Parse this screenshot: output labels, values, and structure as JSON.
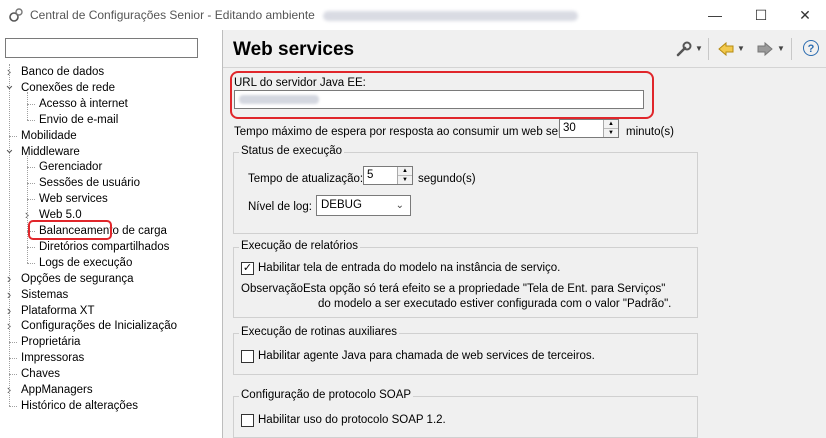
{
  "window": {
    "title": "Central de Configurações Senior - Editando ambiente",
    "minimize": "—",
    "maximize": "☐",
    "close": "✕"
  },
  "sidebar": {
    "search_value": "",
    "items": [
      {
        "label": "Banco de dados",
        "level": 0,
        "toggle": ">"
      },
      {
        "label": "Conexões de rede",
        "level": 0,
        "toggle": "v"
      },
      {
        "label": "Acesso à internet",
        "level": 1,
        "toggle": ""
      },
      {
        "label": "Envio de e-mail",
        "level": 1,
        "toggle": ""
      },
      {
        "label": "Mobilidade",
        "level": 0,
        "toggle": ""
      },
      {
        "label": "Middleware",
        "level": 0,
        "toggle": "v"
      },
      {
        "label": "Gerenciador",
        "level": 1,
        "toggle": ""
      },
      {
        "label": "Sessões de usuário",
        "level": 1,
        "toggle": ""
      },
      {
        "label": "Web services",
        "level": 1,
        "toggle": ""
      },
      {
        "label": "Web 5.0",
        "level": 1,
        "toggle": ">"
      },
      {
        "label": "Balanceamento de carga",
        "level": 1,
        "toggle": ""
      },
      {
        "label": "Diretórios compartilhados",
        "level": 1,
        "toggle": ""
      },
      {
        "label": "Logs de execução",
        "level": 1,
        "toggle": ""
      },
      {
        "label": "Opções de segurança",
        "level": 0,
        "toggle": ">"
      },
      {
        "label": "Sistemas",
        "level": 0,
        "toggle": ">"
      },
      {
        "label": "Plataforma XT",
        "level": 0,
        "toggle": ">"
      },
      {
        "label": "Configurações de Inicialização",
        "level": 0,
        "toggle": ">"
      },
      {
        "label": "Proprietária",
        "level": 0,
        "toggle": ""
      },
      {
        "label": "Impressoras",
        "level": 0,
        "toggle": ""
      },
      {
        "label": "Chaves",
        "level": 0,
        "toggle": ""
      },
      {
        "label": "AppManagers",
        "level": 0,
        "toggle": ">"
      },
      {
        "label": "Histórico de alterações",
        "level": 0,
        "toggle": ""
      }
    ]
  },
  "main": {
    "title": "Web services",
    "toolbar": {
      "help": "?"
    },
    "url_label": "URL do servidor Java EE:",
    "timeout_label": "Tempo máximo de espera por resposta ao consumir um web service:",
    "timeout_value": "30",
    "timeout_unit": "minuto(s)",
    "status_group": {
      "title": "Status de execução",
      "refresh_label": "Tempo de atualização:",
      "refresh_value": "5",
      "refresh_unit": "segundo(s)",
      "log_label": "Nível de log:",
      "log_value": "DEBUG"
    },
    "reports_group": {
      "title": "Execução de relatórios",
      "checkbox_label": "Habilitar tela de entrada do modelo na instância de serviço.",
      "checked": true,
      "note_label": "Observação:",
      "note_line1": "Esta opção só terá efeito se a propriedade \"Tela de Ent. para Serviços\"",
      "note_line2": "do modelo a ser executado estiver configurada com o valor \"Padrão\"."
    },
    "aux_group": {
      "title": "Execução de rotinas auxiliares",
      "checkbox_label": "Habilitar agente Java para chamada de web services de terceiros.",
      "checked": false
    },
    "soap_group": {
      "title": "Configuração de protocolo SOAP",
      "checkbox_label": "Habilitar uso do protocolo SOAP 1.2.",
      "checked": false
    }
  }
}
